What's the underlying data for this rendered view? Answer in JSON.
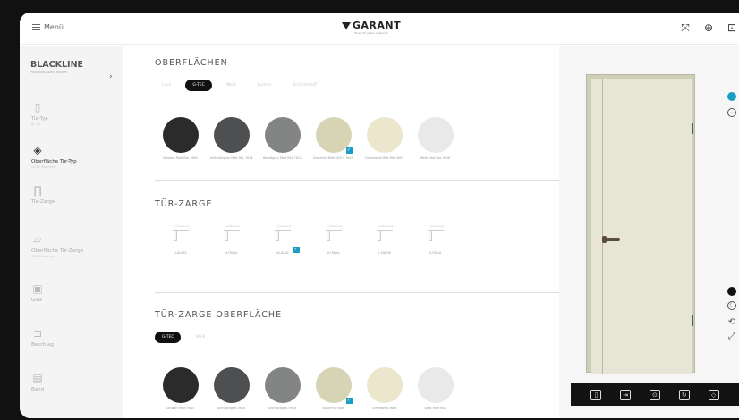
{
  "topbar": {
    "menu_label": "Menü",
    "brand_name": "GARANT",
    "brand_tagline": "Türen für jeden Anspruch"
  },
  "sidebar": {
    "title": "BLACKLINE",
    "subtitle": "Produktauswahl ändern",
    "items": [
      {
        "label": "Tür-Typ",
        "value": "BL 44",
        "icon": "door-icon"
      },
      {
        "label": "Oberfläche Tür-Typ",
        "value": "G-TEC Kaschmir",
        "icon": "layers-icon"
      },
      {
        "label": "Tür-Zarge",
        "value": "",
        "icon": "frame-icon"
      },
      {
        "label": "Oberfläche Tür-Zarge",
        "value": "G-TEC Kaschmir",
        "icon": "frame-surface-icon"
      },
      {
        "label": "Glas",
        "value": "",
        "icon": "glass-icon"
      },
      {
        "label": "Beschlag",
        "value": "",
        "icon": "fitting-icon"
      },
      {
        "label": "Band",
        "value": "",
        "icon": "hinge-icon"
      }
    ]
  },
  "surfaces": {
    "title": "OBERFLÄCHEN",
    "tabs": [
      "Lack",
      "G-TEC",
      "Weiß",
      "Furnier",
      "Schichtstoff"
    ],
    "active_tab": "G-TEC",
    "swatches": [
      {
        "label": "Schwarz Matt RAL 9005",
        "color": "#2b2b2b",
        "selected": false
      },
      {
        "label": "Anthrazitgrau Matt RAL 7016",
        "color": "#4e4f50",
        "selected": false
      },
      {
        "label": "Basaltgrau Matt RAL 7012",
        "color": "#838484",
        "selected": false
      },
      {
        "label": "Kaschmir Matt NCS S 1005",
        "color": "#d6d4b5",
        "selected": true
      },
      {
        "label": "Cremeweiß Matt RAL 9001",
        "color": "#ece7cc",
        "selected": false
      },
      {
        "label": "Weiß Matt RAL 9016",
        "color": "#e9e9e9",
        "selected": false
      }
    ]
  },
  "frames": {
    "title": "TÜR-ZARGE",
    "items": [
      {
        "caption": "Umfassung",
        "label": "U-ALUZ0",
        "selected": false
      },
      {
        "caption": "Umfassung",
        "label": "U-ITALIA",
        "selected": false
      },
      {
        "caption": "Umfassung",
        "label": "AS-ALU0",
        "selected": true
      },
      {
        "caption": "Umfassung",
        "label": "U-ITALIA",
        "selected": false
      },
      {
        "caption": "Umfassung",
        "label": "U-ZARGE",
        "selected": false
      },
      {
        "caption": "Umfassung",
        "label": "U-ITALIA",
        "selected": false
      }
    ]
  },
  "frame_surface": {
    "title": "TÜR-ZARGE OBERFLÄCHE",
    "tabs": [
      "G-TEC",
      "Weiß"
    ],
    "active_tab": "G-TEC",
    "swatches": [
      {
        "label": "Schwarz Matt 9005",
        "color": "#2b2b2b",
        "selected": false
      },
      {
        "label": "Anthrazitgrau Matt",
        "color": "#4e4f50",
        "selected": false
      },
      {
        "label": "Anthrazitgrau Matt",
        "color": "#838484",
        "selected": false
      },
      {
        "label": "Kaschmir Matt",
        "color": "#d6d4b5",
        "selected": true
      },
      {
        "label": "Cremeweiß Matt",
        "color": "#ece7cc",
        "selected": false
      },
      {
        "label": "Weiß Matt RAL",
        "color": "#e9e9e9",
        "selected": false
      }
    ]
  },
  "viewer": {
    "accent": "#1a9ec3",
    "door_color": "#e7e6d6",
    "frame_color": "#cfcfb8",
    "handle_color": "#5a4c40"
  }
}
